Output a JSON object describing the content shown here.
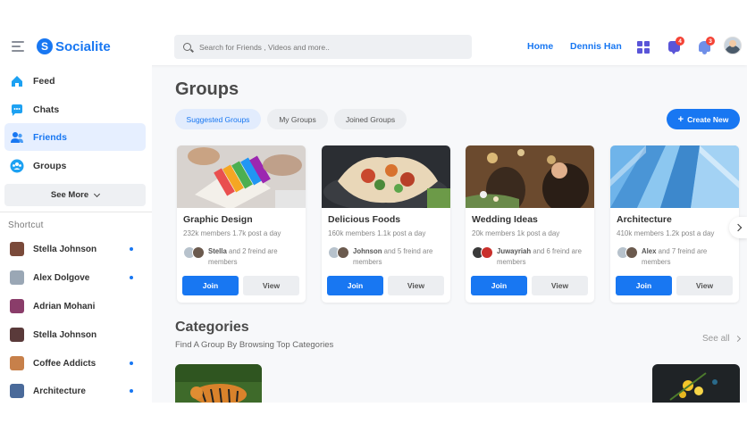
{
  "header": {
    "logo_letter": "S",
    "logo_text": "Socialite",
    "search_placeholder": "Search for Friends , Videos and more..",
    "nav_home": "Home",
    "nav_user": "Dennis Han",
    "messages_badge": "4",
    "notifications_badge": "3",
    "icons": [
      "menu-icon",
      "apps-grid-icon",
      "message-icon",
      "bell-icon"
    ]
  },
  "sidebar": {
    "items": [
      {
        "label": "Feed",
        "icon": "home-icon",
        "color": "#1da1f2"
      },
      {
        "label": "Chats",
        "icon": "chat-icon",
        "color": "#1da1f2"
      },
      {
        "label": "Friends",
        "icon": "friends-icon",
        "color": "#1877f2",
        "active": true
      },
      {
        "label": "Groups",
        "icon": "groups-icon",
        "color": "#1da1f2"
      }
    ],
    "see_more": "See More",
    "shortcut_title": "Shortcut",
    "shortcuts": [
      {
        "name": "Stella Johnson",
        "online": true,
        "color": "#7a4a3a"
      },
      {
        "name": "Alex Dolgove",
        "online": true,
        "color": "#9aa7b5"
      },
      {
        "name": "Adrian Mohani",
        "online": false,
        "color": "#8a3d6a"
      },
      {
        "name": "Stella Johnson",
        "online": false,
        "color": "#5a3a3a"
      },
      {
        "name": "Coffee Addicts",
        "online": true,
        "color": "#c7804a"
      },
      {
        "name": "Architecture",
        "online": true,
        "color": "#4a6a9a"
      }
    ]
  },
  "main": {
    "title": "Groups",
    "tabs": [
      "Suggested Groups",
      "My Groups",
      "Joined Groups"
    ],
    "create_button": "Create New",
    "groups": [
      {
        "title": "Graphic Design",
        "meta": "232k members 1.7k post a day",
        "friend": "Stella",
        "friend_suffix": "and 2 freind are members",
        "join": "Join",
        "view": "View"
      },
      {
        "title": "Delicious Foods",
        "meta": "160k members 1.1k post a day",
        "friend": "Johnson",
        "friend_suffix": "and 5 freind are members",
        "join": "Join",
        "view": "View"
      },
      {
        "title": "Wedding Ideas",
        "meta": "20k members 1k post a day",
        "friend": "Juwayriah",
        "friend_suffix": "and 6 freind are members",
        "join": "Join",
        "view": "View"
      },
      {
        "title": "Architecture",
        "meta": "410k members 1.2k post a day",
        "friend": "Alex",
        "friend_suffix": "and 7 freind are members",
        "join": "Join",
        "view": "View"
      }
    ],
    "categories_title": "Categories",
    "categories_subtitle": "Find A Group By Browsing Top Categories",
    "see_all": "See all"
  },
  "colors": {
    "accent": "#1877f2",
    "active_bg": "#e6efff",
    "badge_red": "#f44336",
    "icon_purple": "#5a55d8"
  }
}
